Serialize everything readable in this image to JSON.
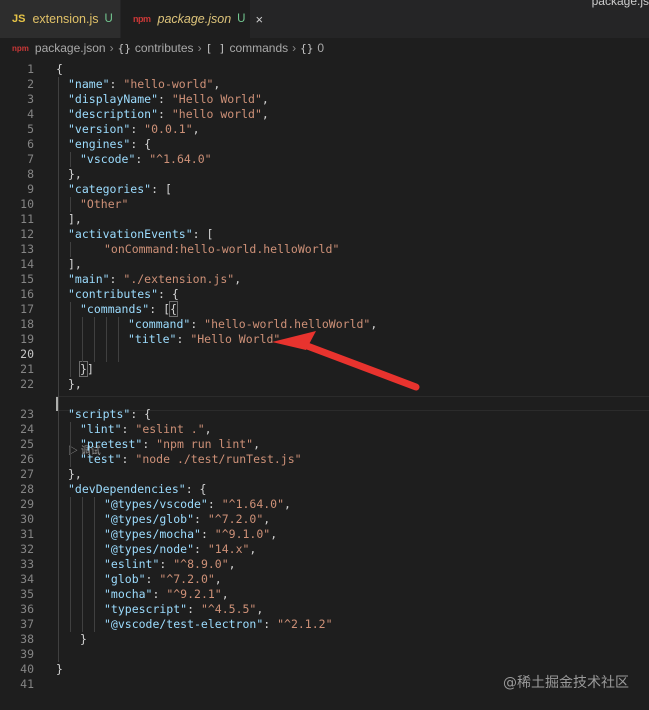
{
  "tabs": [
    {
      "icon": "JS",
      "label": "extension.js",
      "badge": "U"
    },
    {
      "icon": "npm",
      "label": "package.json",
      "badge": "U",
      "close": "×"
    }
  ],
  "tab_overflow": "package.js",
  "breadcrumb": {
    "file": "package.json",
    "items": [
      {
        "sym": "{}",
        "label": "contributes"
      },
      {
        "sym": "[ ]",
        "label": "commands"
      },
      {
        "sym": "{}",
        "label": "0"
      }
    ],
    "sep": "›"
  },
  "codelens": "▷ 调试",
  "watermark": "@稀土掘金技术社区",
  "colors": {
    "key": "#9cdcfe",
    "string": "#ce9178",
    "arrow": "#e8332e"
  },
  "lines": [
    {
      "n": "1",
      "indent": 0,
      "t": [
        [
          "p",
          "{"
        ]
      ]
    },
    {
      "n": "2",
      "indent": 1,
      "t": [
        [
          "k",
          "\"name\""
        ],
        [
          "p",
          ": "
        ],
        [
          "s",
          "\"hello-world\""
        ],
        [
          "p",
          ","
        ]
      ]
    },
    {
      "n": "3",
      "indent": 1,
      "t": [
        [
          "k",
          "\"displayName\""
        ],
        [
          "p",
          ": "
        ],
        [
          "s",
          "\"Hello World\""
        ],
        [
          "p",
          ","
        ]
      ]
    },
    {
      "n": "4",
      "indent": 1,
      "t": [
        [
          "k",
          "\"description\""
        ],
        [
          "p",
          ": "
        ],
        [
          "s",
          "\"hello world\""
        ],
        [
          "p",
          ","
        ]
      ]
    },
    {
      "n": "5",
      "indent": 1,
      "t": [
        [
          "k",
          "\"version\""
        ],
        [
          "p",
          ": "
        ],
        [
          "s",
          "\"0.0.1\""
        ],
        [
          "p",
          ","
        ]
      ]
    },
    {
      "n": "6",
      "indent": 1,
      "t": [
        [
          "k",
          "\"engines\""
        ],
        [
          "p",
          ": {"
        ]
      ]
    },
    {
      "n": "7",
      "indent": 2,
      "t": [
        [
          "k",
          "\"vscode\""
        ],
        [
          "p",
          ": "
        ],
        [
          "s",
          "\"^1.64.0\""
        ]
      ]
    },
    {
      "n": "8",
      "indent": 1,
      "t": [
        [
          "p",
          "},"
        ]
      ]
    },
    {
      "n": "9",
      "indent": 1,
      "t": [
        [
          "k",
          "\"categories\""
        ],
        [
          "p",
          ": ["
        ]
      ]
    },
    {
      "n": "10",
      "indent": 2,
      "t": [
        [
          "s",
          "\"Other\""
        ]
      ]
    },
    {
      "n": "11",
      "indent": 1,
      "t": [
        [
          "p",
          "],"
        ]
      ]
    },
    {
      "n": "12",
      "indent": 1,
      "t": [
        [
          "k",
          "\"activationEvents\""
        ],
        [
          "p",
          ": ["
        ]
      ]
    },
    {
      "n": "13",
      "indent": 4,
      "t": [
        [
          "s",
          "\"onCommand:hello-world.helloWorld\""
        ]
      ]
    },
    {
      "n": "14",
      "indent": 1,
      "t": [
        [
          "p",
          "],"
        ]
      ]
    },
    {
      "n": "15",
      "indent": 1,
      "t": [
        [
          "k",
          "\"main\""
        ],
        [
          "p",
          ": "
        ],
        [
          "s",
          "\"./extension.js\""
        ],
        [
          "p",
          ","
        ]
      ]
    },
    {
      "n": "16",
      "indent": 1,
      "t": [
        [
          "k",
          "\"contributes\""
        ],
        [
          "p",
          ": {"
        ]
      ]
    },
    {
      "n": "17",
      "indent": 2,
      "t": [
        [
          "k",
          "\"commands\""
        ],
        [
          "p",
          ": ["
        ],
        [
          "p",
          "{"
        ]
      ]
    },
    {
      "n": "18",
      "indent": 6,
      "t": [
        [
          "k",
          "\"command\""
        ],
        [
          "p",
          ": "
        ],
        [
          "s",
          "\"hello-world.helloWorld\""
        ],
        [
          "p",
          ","
        ]
      ]
    },
    {
      "n": "19",
      "indent": 6,
      "t": [
        [
          "k",
          "\"title\""
        ],
        [
          "p",
          ": "
        ],
        [
          "s",
          "\"Hello World\""
        ]
      ]
    },
    {
      "n": "20",
      "indent": 0,
      "t": []
    },
    {
      "n": "21",
      "indent": 2,
      "t": [
        [
          "p",
          "}"
        ],
        [
          "p",
          "]"
        ]
      ]
    },
    {
      "n": "22",
      "indent": 1,
      "t": [
        [
          "p",
          "},"
        ]
      ]
    },
    {
      "n": "23",
      "indent": 1,
      "t": [
        [
          "k",
          "\"scripts\""
        ],
        [
          "p",
          ": {"
        ]
      ]
    },
    {
      "n": "24",
      "indent": 2,
      "t": [
        [
          "k",
          "\"lint\""
        ],
        [
          "p",
          ": "
        ],
        [
          "s",
          "\"eslint .\""
        ],
        [
          "p",
          ","
        ]
      ]
    },
    {
      "n": "25",
      "indent": 2,
      "t": [
        [
          "k",
          "\"pretest\""
        ],
        [
          "p",
          ": "
        ],
        [
          "s",
          "\"npm run lint\""
        ],
        [
          "p",
          ","
        ]
      ]
    },
    {
      "n": "26",
      "indent": 2,
      "t": [
        [
          "k",
          "\"test\""
        ],
        [
          "p",
          ": "
        ],
        [
          "s",
          "\"node ./test/runTest.js\""
        ]
      ]
    },
    {
      "n": "27",
      "indent": 1,
      "t": [
        [
          "p",
          "},"
        ]
      ]
    },
    {
      "n": "28",
      "indent": 1,
      "t": [
        [
          "k",
          "\"devDependencies\""
        ],
        [
          "p",
          ": {"
        ]
      ]
    },
    {
      "n": "29",
      "indent": 4,
      "t": [
        [
          "k",
          "\"@types/vscode\""
        ],
        [
          "p",
          ": "
        ],
        [
          "s",
          "\"^1.64.0\""
        ],
        [
          "p",
          ","
        ]
      ]
    },
    {
      "n": "30",
      "indent": 4,
      "t": [
        [
          "k",
          "\"@types/glob\""
        ],
        [
          "p",
          ": "
        ],
        [
          "s",
          "\"^7.2.0\""
        ],
        [
          "p",
          ","
        ]
      ]
    },
    {
      "n": "31",
      "indent": 4,
      "t": [
        [
          "k",
          "\"@types/mocha\""
        ],
        [
          "p",
          ": "
        ],
        [
          "s",
          "\"^9.1.0\""
        ],
        [
          "p",
          ","
        ]
      ]
    },
    {
      "n": "32",
      "indent": 4,
      "t": [
        [
          "k",
          "\"@types/node\""
        ],
        [
          "p",
          ": "
        ],
        [
          "s",
          "\"14.x\""
        ],
        [
          "p",
          ","
        ]
      ]
    },
    {
      "n": "33",
      "indent": 4,
      "t": [
        [
          "k",
          "\"eslint\""
        ],
        [
          "p",
          ": "
        ],
        [
          "s",
          "\"^8.9.0\""
        ],
        [
          "p",
          ","
        ]
      ]
    },
    {
      "n": "34",
      "indent": 4,
      "t": [
        [
          "k",
          "\"glob\""
        ],
        [
          "p",
          ": "
        ],
        [
          "s",
          "\"^7.2.0\""
        ],
        [
          "p",
          ","
        ]
      ]
    },
    {
      "n": "35",
      "indent": 4,
      "t": [
        [
          "k",
          "\"mocha\""
        ],
        [
          "p",
          ": "
        ],
        [
          "s",
          "\"^9.2.1\""
        ],
        [
          "p",
          ","
        ]
      ]
    },
    {
      "n": "36",
      "indent": 4,
      "t": [
        [
          "k",
          "\"typescript\""
        ],
        [
          "p",
          ": "
        ],
        [
          "s",
          "\"^4.5.5\""
        ],
        [
          "p",
          ","
        ]
      ]
    },
    {
      "n": "37",
      "indent": 4,
      "t": [
        [
          "k",
          "\"@vscode/test-electron\""
        ],
        [
          "p",
          ": "
        ],
        [
          "s",
          "\"^2.1.2\""
        ]
      ]
    },
    {
      "n": "38",
      "indent": 2,
      "t": [
        [
          "p",
          "}"
        ]
      ]
    },
    {
      "n": "39",
      "indent": 0,
      "t": []
    },
    {
      "n": "40",
      "indent": 0,
      "t": [
        [
          "p",
          "}"
        ]
      ]
    },
    {
      "n": "41",
      "indent": 0,
      "t": []
    }
  ]
}
